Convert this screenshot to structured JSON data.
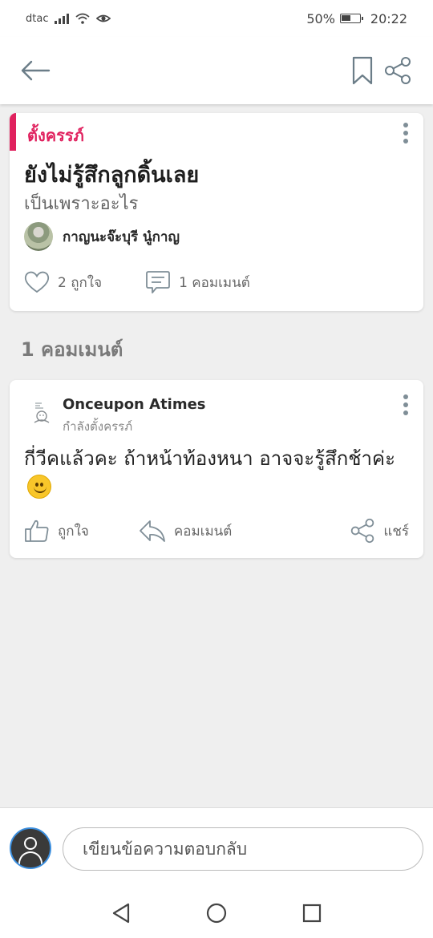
{
  "status_bar": {
    "carrier": "dtac",
    "battery": "50%",
    "time": "20:22"
  },
  "post": {
    "category": "ตั้งครรภ์",
    "title": "ยังไม่รู้สึกลูกดิ้นเลย",
    "subtitle": "เป็นเพราะอะไร",
    "author": "กาญนะจ๊ะบุรี นู๋กาญ",
    "likes": "2 ถูกใจ",
    "comments": "1 คอมเมนต์"
  },
  "comments_section": {
    "title": "1 คอมเมนต์"
  },
  "comment": {
    "author": "Onceupon Atimes",
    "status": "กำลังตั้งครรภ์",
    "text": "กี่วีคแล้วคะ ถ้าหน้าท้องหนา อาจจะรู้สึกช้าค่ะ",
    "actions": {
      "like": "ถูกใจ",
      "reply": "คอมเมนต์",
      "share": "แชร์"
    }
  },
  "composer": {
    "placeholder": "เขียนข้อความตอบกลับ"
  },
  "colors": {
    "accent": "#e0215e",
    "icon_gray": "#7f8e97"
  }
}
